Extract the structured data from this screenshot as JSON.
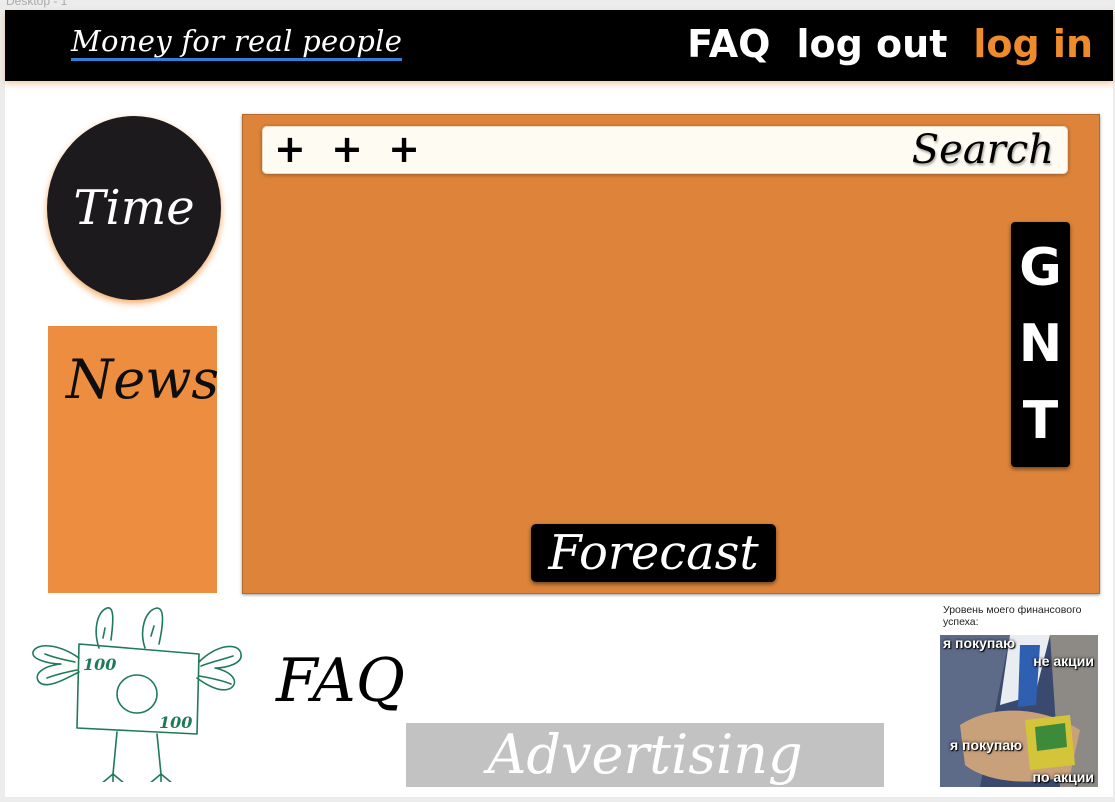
{
  "frame": {
    "label": "Desktop - 1"
  },
  "header": {
    "brand": "Money for real people",
    "nav": {
      "faq": "FAQ",
      "logout": "log out",
      "login": "log in"
    }
  },
  "sidebar": {
    "time": "Time",
    "news": "News"
  },
  "main": {
    "search": {
      "plus_label": "+ + +",
      "label": "Search"
    },
    "gnt": [
      "G",
      "N",
      "T"
    ],
    "forecast": "Forecast"
  },
  "mascot": {
    "note_top": "100",
    "note_bottom": "100"
  },
  "footer": {
    "faq": "FAQ",
    "advertising": "Advertising"
  },
  "meme": {
    "caption": "Уровень моего финансового успеха:",
    "line1": "я покупаю",
    "line2": "не акции",
    "line3": "я покупаю",
    "line4": "по акции"
  },
  "colors": {
    "accent": "#ee8b2b",
    "panel": "#dd843a",
    "news": "#ec8d3f",
    "header": "#000000"
  }
}
